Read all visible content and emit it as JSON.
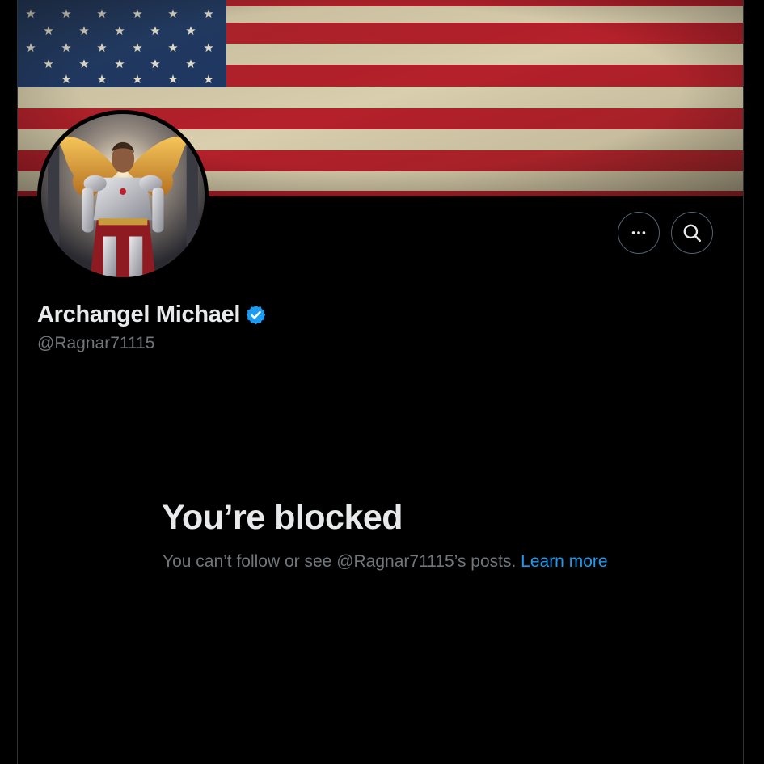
{
  "profile": {
    "display_name": "Archangel Michael",
    "handle": "@Ragnar71115",
    "verified": true,
    "verified_badge_color": "#1d9bf0",
    "banner_description_icon": "american-flag-banner",
    "avatar_icon": "archangel-warrior-avatar"
  },
  "actions": {
    "more_icon": "more-dots-icon",
    "search_icon": "search-icon"
  },
  "blocked": {
    "title": "You’re blocked",
    "message": "You can’t follow or see @Ragnar71115’s posts. ",
    "link_label": "Learn more"
  },
  "colors": {
    "background": "#000000",
    "text_primary": "#e7e9ea",
    "text_secondary": "#71767b",
    "link": "#1d9bf0",
    "border": "#2f3336"
  }
}
